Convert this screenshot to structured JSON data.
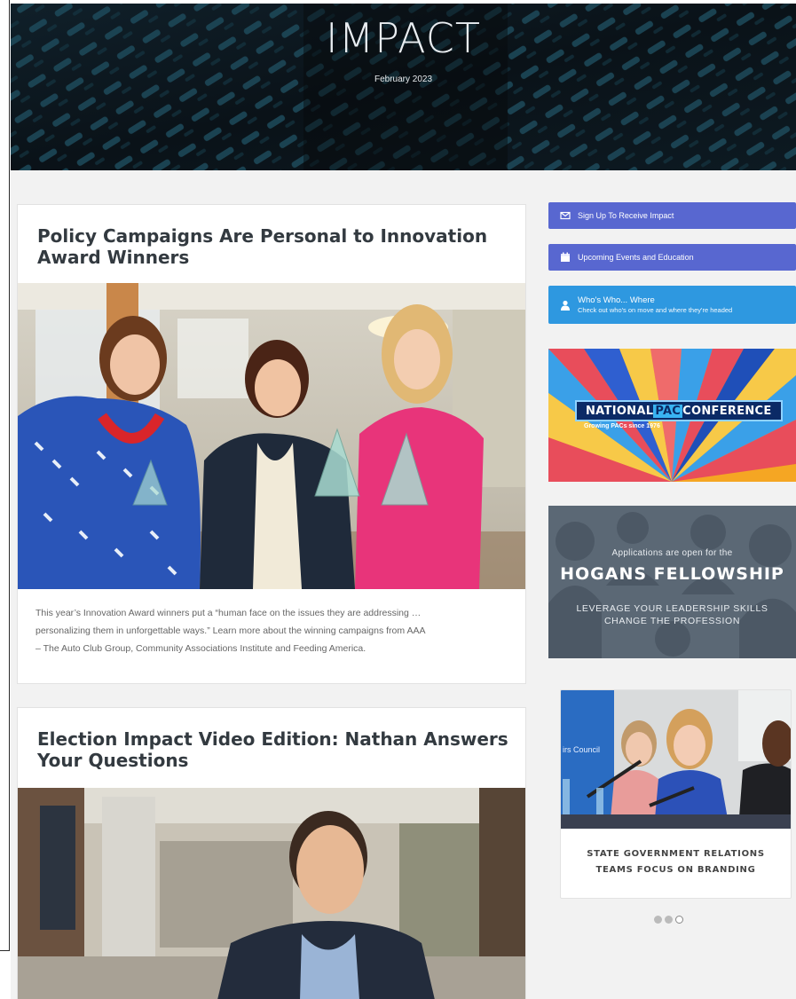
{
  "hero": {
    "title": "IMPACT",
    "date": "February 2023"
  },
  "articles": [
    {
      "title_line1": "Policy Campaigns Are Personal to Innovation",
      "title_line2": "Award Winners",
      "excerpt_line1": "This year’s Innovation Award winners put a “human face on the issues they are addressing …",
      "excerpt_line2": "personalizing them in unforgettable ways.” Learn more about the winning campaigns from AAA",
      "excerpt_line3": "– The Auto Club Group, Community Associations Institute and Feeding America."
    },
    {
      "title_line1": "Election Impact Video Edition: Nathan Answers",
      "title_line2": "Your Questions"
    }
  ],
  "sidebar": {
    "signup_label": "Sign Up To Receive Impact",
    "events_label": "Upcoming Events and Education",
    "whos_title": "Who's Who... Where",
    "whos_subtitle": "Check out who's on move and where they're headed",
    "npc": {
      "name_part1": "NATIONAL",
      "name_part2": "PAC",
      "name_part3": "CONFERENCE",
      "tagline": "Growing PACs since 1976"
    },
    "hogans": {
      "line1": "Applications are open for the",
      "line2": "HOGANS FELLOWSHIP",
      "line3": "LEVERAGE YOUR LEADERSHIP SKILLS",
      "line4": "CHANGE THE PROFESSION"
    },
    "slider": {
      "caption_line1": "STATE GOVERNMENT RELATIONS",
      "caption_line2": "TEAMS FOCUS ON BRANDING",
      "photo_text": "irs Council",
      "slides": 3,
      "active_slide": 3
    }
  },
  "colors": {
    "button_purple": "#5867d0",
    "button_blue": "#2e98e0",
    "page_bg": "#f2f2f2"
  }
}
